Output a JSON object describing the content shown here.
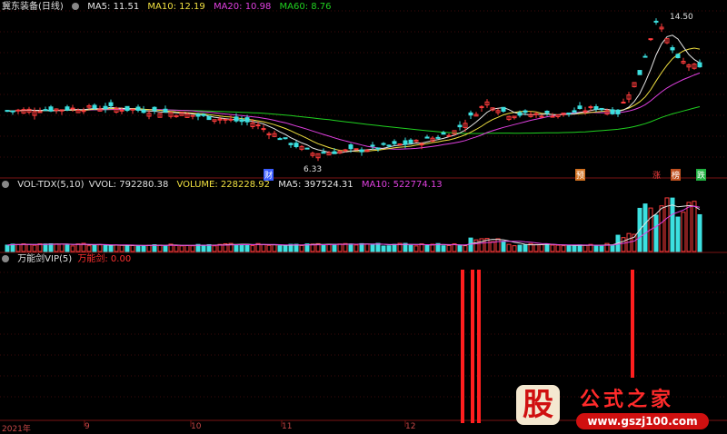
{
  "colors": {
    "up": "#ff3c3c",
    "down": "#3ce0e0",
    "ma5": "#e6e6e6",
    "ma10": "#f0e040",
    "ma20": "#e040e0",
    "ma60": "#20d020",
    "grid": "#7a1414",
    "signal": "#ff1e1e"
  },
  "price_panel": {
    "title": "冀东装备(日线)",
    "ma_labels": [
      "MA5: 11.51",
      "MA10: 12.19",
      "MA20: 10.98",
      "MA60: 8.76"
    ],
    "high_label": "14.50",
    "low_label": "6.33",
    "markers": [
      "财",
      "预",
      "涨",
      "榜",
      "跌"
    ]
  },
  "volume_panel": {
    "labels": [
      "VOL-TDX(5,10)",
      "VVOL: 792280.38",
      "VOLUME: 228228.92",
      "MA5: 397524.31",
      "MA10: 522774.13"
    ]
  },
  "indicator_panel": {
    "labels": [
      "万能剑VIP(5)",
      "万能剑: 0.00"
    ]
  },
  "x_axis": {
    "ticks": [
      "2021年",
      "9",
      "10",
      "11",
      "12"
    ]
  },
  "watermark": {
    "glyph": "股",
    "name": "公式之家",
    "url": "www.gszj100.com"
  },
  "chart_data": [
    {
      "type": "candlestick",
      "title": "冀东装备(日线)",
      "series": [
        {
          "name": "MA5",
          "values": [
            11.51
          ]
        },
        {
          "name": "MA10",
          "values": [
            12.19
          ]
        },
        {
          "name": "MA20",
          "values": [
            10.98
          ]
        },
        {
          "name": "MA60",
          "values": [
            8.76
          ]
        }
      ],
      "annotations": {
        "high": 14.5,
        "low": 6.33
      },
      "ylim": [
        6.0,
        15.0
      ]
    },
    {
      "type": "bar",
      "title": "VOL-TDX(5,10)",
      "series": [
        {
          "name": "VVOL",
          "values": [
            792280.38
          ]
        },
        {
          "name": "VOLUME",
          "values": [
            228228.92
          ]
        },
        {
          "name": "MA5",
          "values": [
            397524.31
          ]
        },
        {
          "name": "MA10",
          "values": [
            522774.13
          ]
        }
      ]
    },
    {
      "type": "bar",
      "title": "万能剑VIP(5)",
      "series": [
        {
          "name": "万能剑",
          "values": [
            0.0
          ]
        }
      ]
    }
  ]
}
